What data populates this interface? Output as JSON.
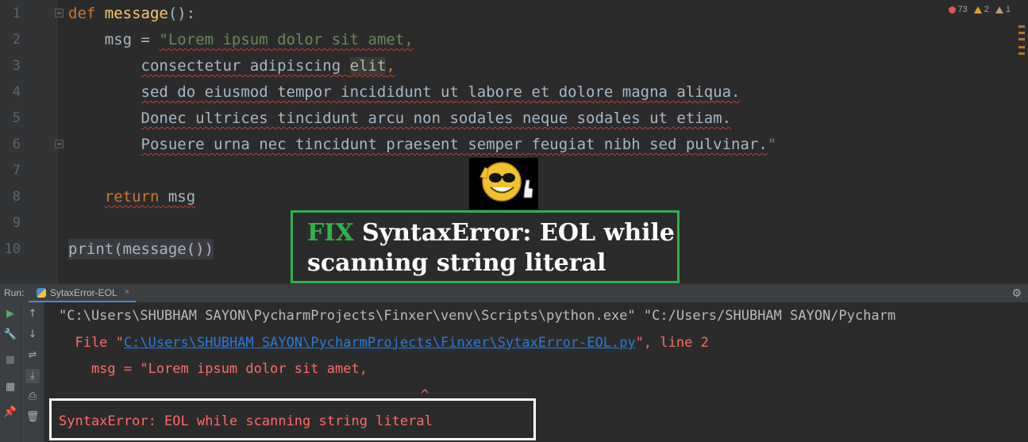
{
  "editor": {
    "line_numbers": [
      "1",
      "2",
      "3",
      "4",
      "5",
      "6",
      "7",
      "8",
      "9",
      "10"
    ],
    "line1": {
      "kw": "def",
      "fn": "message",
      "rest": "():"
    },
    "line2": {
      "indent": "    ",
      "var": "msg = ",
      "str": "\"Lorem ipsum dolor sit amet,"
    },
    "line3": {
      "indent": "        ",
      "text_a": "consectetur adipiscing ",
      "text_b": "elit",
      "text_c": ","
    },
    "line4": {
      "indent": "        ",
      "text": "sed do eiusmod tempor incididunt ut labore et dolore magna aliqua."
    },
    "line5": {
      "indent": "        ",
      "text": "Donec ultrices tincidunt arcu non sodales neque sodales ut etiam."
    },
    "line6": {
      "indent": "        ",
      "text": "Posuere urna nec tincidunt praesent semper feugiat nibh sed pulvinar.",
      "quote": "\""
    },
    "line8": {
      "indent": "    ",
      "kw": "return",
      "rest": " msg"
    },
    "line10": {
      "text": "print(message())"
    },
    "inspections": {
      "errors": "73",
      "warnings": "2",
      "weak_warnings": "1"
    }
  },
  "banner": {
    "fix_word": "FIX",
    "line1_rest": " SyntaxError: EOL while",
    "line2": "scanning string literal"
  },
  "run": {
    "label": "Run:",
    "tab_label": "SytaxError-EOL",
    "tab_close": "×",
    "console": {
      "cmd": "\"C:\\Users\\SHUBHAM SAYON\\PycharmProjects\\Finxer\\venv\\Scripts\\python.exe\" \"C:/Users/SHUBHAM SAYON/Pycharm",
      "file_prefix": "  File \"",
      "file_link": "C:\\Users\\SHUBHAM SAYON\\PycharmProjects\\Finxer\\SytaxError-EOL.py",
      "file_suffix": "\", line 2",
      "code_echo": "    msg = \"Lorem ipsum dolor sit amet,",
      "caret": "^",
      "error": "SyntaxError: EOL while scanning string literal"
    }
  },
  "colors": {
    "keyword": "#cc7832",
    "function": "#ffc66d",
    "string": "#6a8759",
    "error_text": "#ff6b68",
    "link": "#287bde",
    "banner_green": "#2fb24c"
  }
}
